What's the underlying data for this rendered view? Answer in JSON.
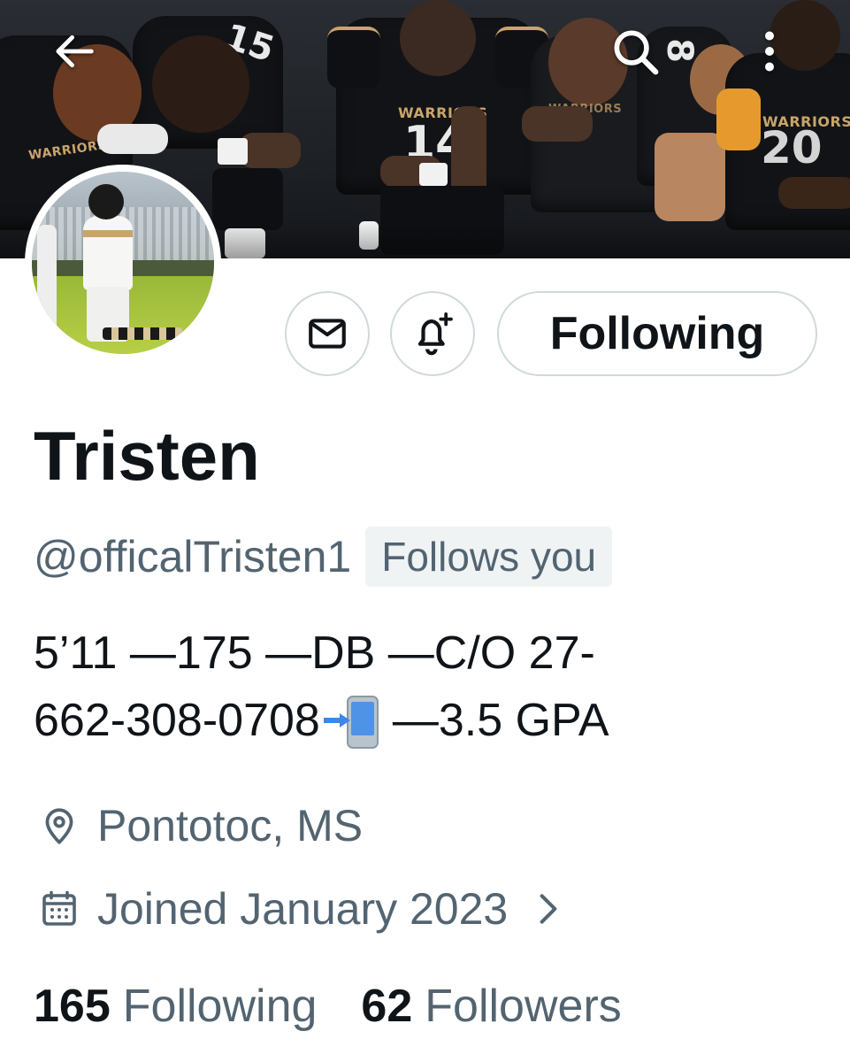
{
  "header": {
    "back_icon": "arrow-left-icon",
    "search_icon": "search-icon",
    "more_icon": "more-vertical-icon",
    "banner": {
      "jersey_text": "WARRIORS",
      "numbers": [
        "14",
        "15",
        "20",
        "8"
      ]
    }
  },
  "actions": {
    "message_icon": "envelope-icon",
    "notify_icon": "bell-plus-icon",
    "follow_label": "Following"
  },
  "profile": {
    "name": "Tristen",
    "handle": "@officalTristen1",
    "follows_you": "Follows you",
    "bio_line1": "5’11 —175 —DB —C/O 27-",
    "bio_line2_a": "662-308-0708",
    "bio_emoji": "mobile-phone-arrow-emoji",
    "bio_line2_b": "—3.5 GPA",
    "location": "Pontotoc, MS",
    "location_icon": "location-pin-icon",
    "joined": "Joined January 2023",
    "joined_icon": "calendar-icon"
  },
  "stats": {
    "following_count": "165",
    "following_label": "Following",
    "followers_count": "62",
    "followers_label": "Followers"
  },
  "colors": {
    "text_primary": "#0f1419",
    "text_secondary": "#536471",
    "border": "#cfd9de",
    "badge_bg": "#eff3f4",
    "accent_gold": "#c9a56a"
  }
}
